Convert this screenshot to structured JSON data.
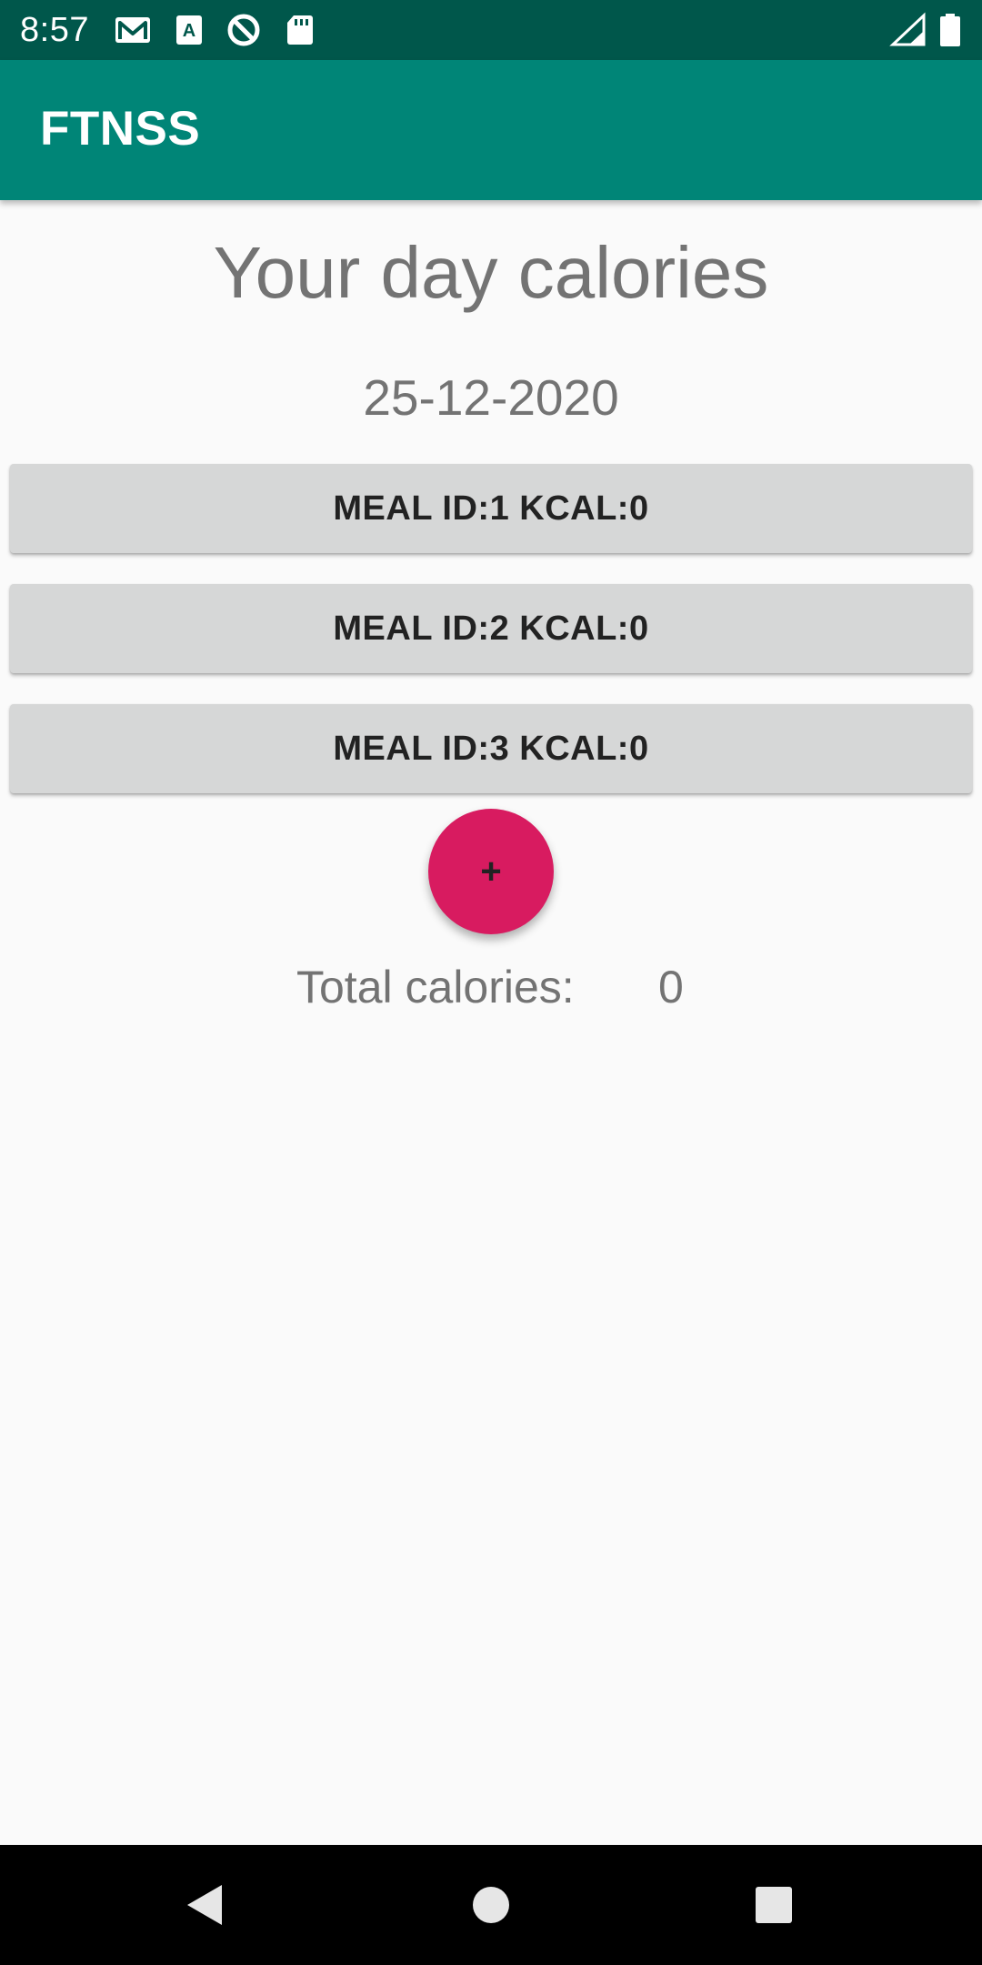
{
  "status_bar": {
    "time": "8:57",
    "icons": [
      "gmail-icon",
      "text-a-icon",
      "sync-icon",
      "sd-card-icon",
      "signal-icon",
      "battery-icon"
    ],
    "background": "#00574B"
  },
  "app_bar": {
    "title": "FTNSS",
    "background": "#008577"
  },
  "main": {
    "heading": "Your day calories",
    "date": "25-12-2020",
    "meals": [
      {
        "label": "MEAL ID:1 KCAL:0"
      },
      {
        "label": "MEAL ID:2 KCAL:0"
      },
      {
        "label": "MEAL ID:3 KCAL:0"
      }
    ],
    "add_button": {
      "label": "+",
      "color": "#D81B60"
    },
    "total_label": "Total calories:",
    "total_value": "0"
  },
  "nav_bar": {
    "buttons": [
      "back-icon",
      "home-icon",
      "recents-icon"
    ]
  }
}
